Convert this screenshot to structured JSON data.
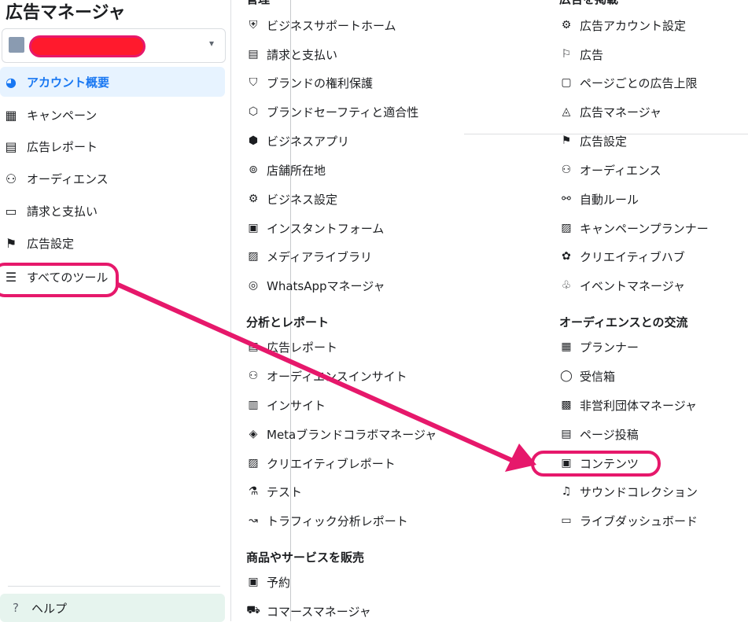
{
  "sidebar": {
    "title": "広告マネージャ",
    "account_chevron": "▾",
    "items": [
      {
        "label": "アカウント概要",
        "icon": "◕"
      },
      {
        "label": "キャンペーン",
        "icon": "▦"
      },
      {
        "label": "広告レポート",
        "icon": "▤"
      },
      {
        "label": "オーディエンス",
        "icon": "⚇"
      },
      {
        "label": "請求と支払い",
        "icon": "▭"
      },
      {
        "label": "広告設定",
        "icon": "⚑"
      },
      {
        "label": "すべてのツール",
        "icon": "☰"
      }
    ],
    "help": {
      "label": "ヘルプ",
      "icon": "?"
    }
  },
  "menu": {
    "col1_top_partial": "管理",
    "col2_top_partial": "広告を掲載",
    "col1_a": [
      {
        "label": "ビジネスサポートホーム",
        "icon": "⛨"
      },
      {
        "label": "請求と支払い",
        "icon": "▤"
      },
      {
        "label": "ブランドの権利保護",
        "icon": "⛉"
      },
      {
        "label": "ブランドセーフティと適合性",
        "icon": "⬡"
      },
      {
        "label": "ビジネスアプリ",
        "icon": "⬢"
      },
      {
        "label": "店舗所在地",
        "icon": "⊚"
      },
      {
        "label": "ビジネス設定",
        "icon": "⚙"
      },
      {
        "label": "インスタントフォーム",
        "icon": "▣"
      },
      {
        "label": "メディアライブラリ",
        "icon": "▨"
      },
      {
        "label": "WhatsAppマネージャ",
        "icon": "◎"
      }
    ],
    "col1_head2": "分析とレポート",
    "col1_b": [
      {
        "label": "広告レポート",
        "icon": "▤"
      },
      {
        "label": "オーディエンスインサイト",
        "icon": "⚇"
      },
      {
        "label": "インサイト",
        "icon": "▥"
      },
      {
        "label": "Metaブランドコラボマネージャ",
        "icon": "◈"
      },
      {
        "label": "クリエイティブレポート",
        "icon": "▨"
      },
      {
        "label": "テスト",
        "icon": "⚗"
      },
      {
        "label": "トラフィック分析レポート",
        "icon": "↝"
      }
    ],
    "col1_head3": "商品やサービスを販売",
    "col1_c": [
      {
        "label": "予約",
        "icon": "▣"
      },
      {
        "label": "コマースマネージャ",
        "icon": "⛟"
      }
    ],
    "col2_a": [
      {
        "label": "広告アカウント設定",
        "icon": "⚙"
      },
      {
        "label": "広告",
        "icon": "⚐"
      },
      {
        "label": "ページごとの広告上限",
        "icon": "▢"
      },
      {
        "label": "広告マネージャ",
        "icon": "◬"
      },
      {
        "label": "広告設定",
        "icon": "⚑"
      },
      {
        "label": "オーディエンス",
        "icon": "⚇"
      },
      {
        "label": "自動ルール",
        "icon": "⚯"
      },
      {
        "label": "キャンペーンプランナー",
        "icon": "▨"
      },
      {
        "label": "クリエイティブハブ",
        "icon": "✿"
      },
      {
        "label": "イベントマネージャ",
        "icon": "♧"
      }
    ],
    "col2_head2": "オーディエンスとの交流",
    "col2_b": [
      {
        "label": "プランナー",
        "icon": "▦"
      },
      {
        "label": "受信箱",
        "icon": "◯"
      },
      {
        "label": "非営利団体マネージャ",
        "icon": "▩"
      },
      {
        "label": "ページ投稿",
        "icon": "▤"
      },
      {
        "label": "コンテンツ",
        "icon": "▣"
      },
      {
        "label": "サウンドコレクション",
        "icon": "♫"
      },
      {
        "label": "ライブダッシュボード",
        "icon": "▭"
      }
    ]
  },
  "colors": {
    "accent": "#1877f2",
    "annotation": "#e6186b"
  }
}
